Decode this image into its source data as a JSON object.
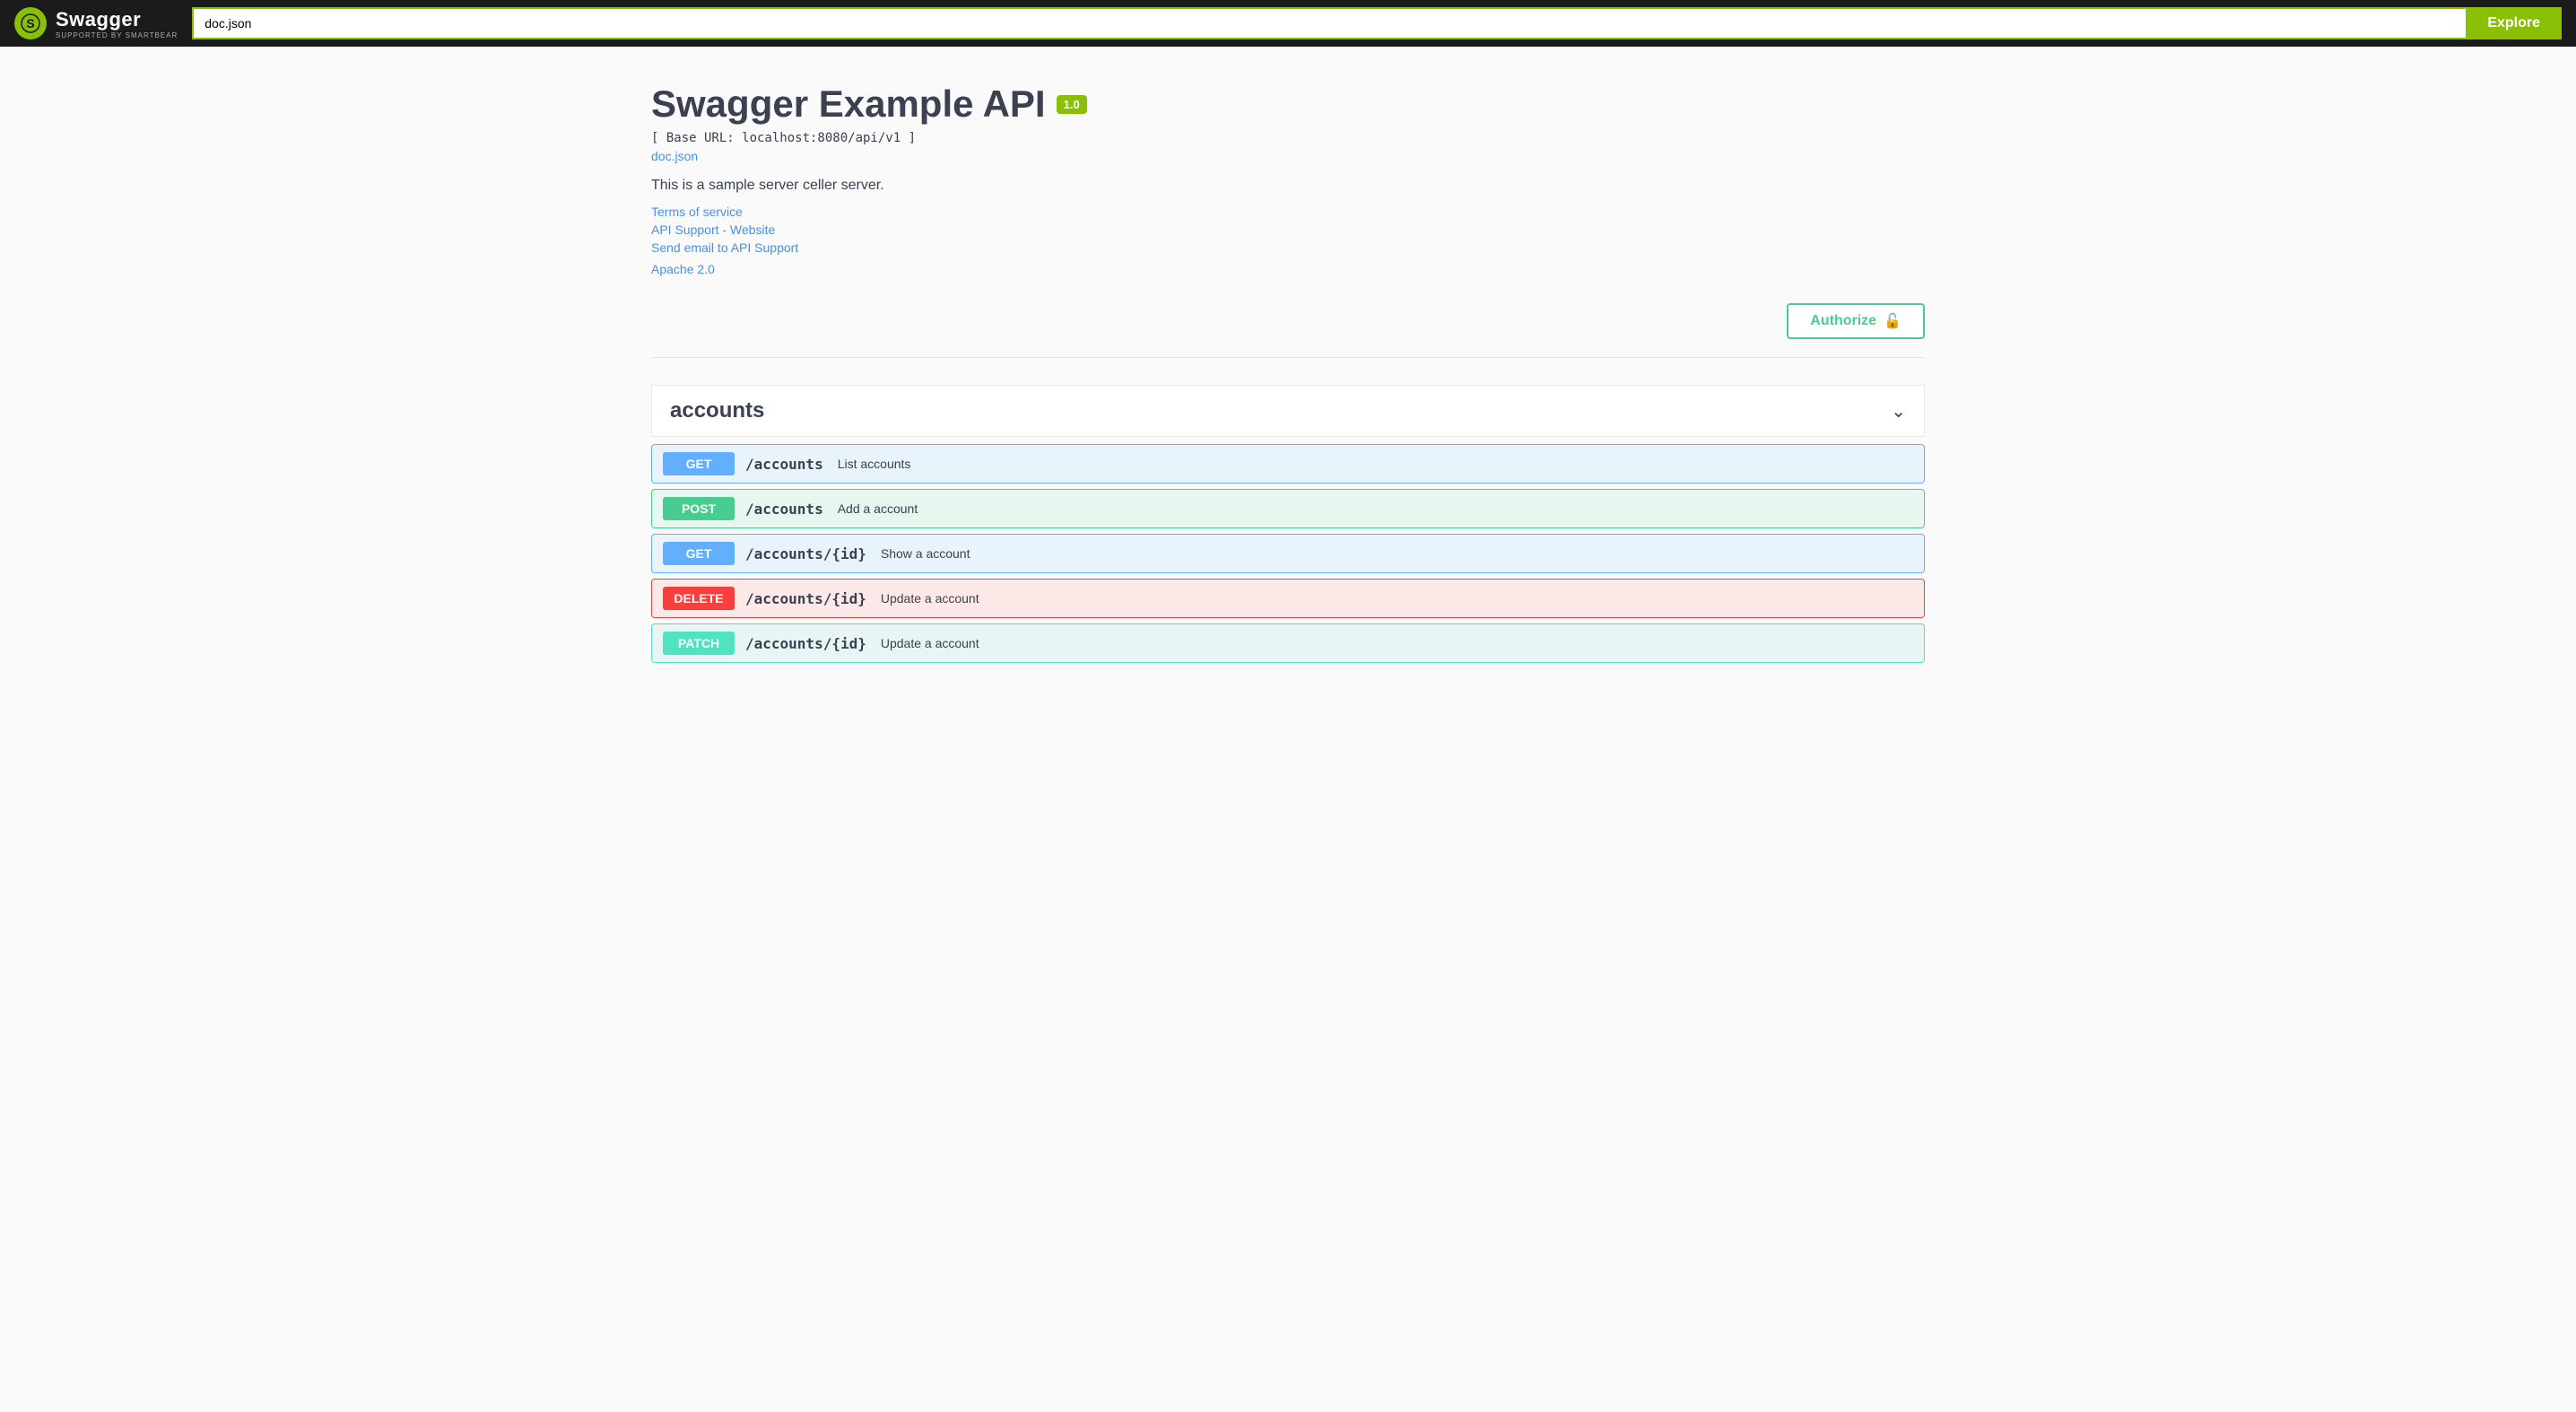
{
  "header": {
    "logo_title": "Swagger",
    "logo_subtitle": "Supported by SMARTBEAR",
    "search_value": "doc.json",
    "explore_label": "Explore"
  },
  "api": {
    "title": "Swagger Example API",
    "version": "1.0",
    "base_url": "[ Base URL: localhost:8080/api/v1 ]",
    "doc_link": "doc.json",
    "description": "This is a sample server celler server.",
    "terms_of_service": "Terms of service",
    "support_website": "API Support - Website",
    "support_email": "Send email to API Support",
    "license": "Apache 2.0"
  },
  "authorize": {
    "label": "Authorize",
    "icon": "🔓"
  },
  "sections": [
    {
      "name": "accounts",
      "endpoints": [
        {
          "method": "get",
          "path": "/accounts",
          "description": "List accounts"
        },
        {
          "method": "post",
          "path": "/accounts",
          "description": "Add a account"
        },
        {
          "method": "get",
          "path": "/accounts/{id}",
          "description": "Show a account"
        },
        {
          "method": "delete",
          "path": "/accounts/{id}",
          "description": "Update a account"
        },
        {
          "method": "patch",
          "path": "/accounts/{id}",
          "description": "Update a account"
        }
      ]
    }
  ]
}
